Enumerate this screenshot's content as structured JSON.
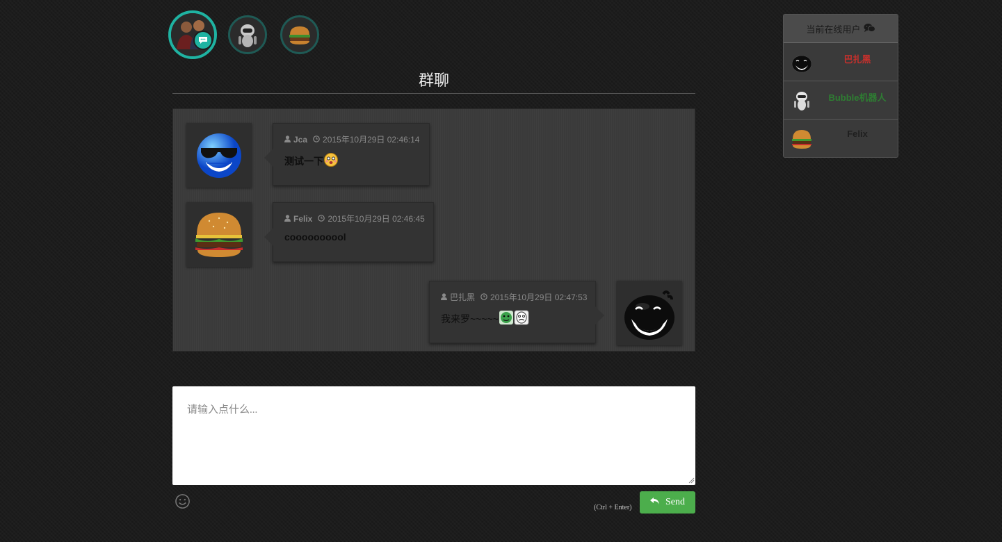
{
  "page_title": "群聊",
  "messages": [
    {
      "user": "Jca",
      "time": "2015年10月29日 02:46:14",
      "text": "测试一下",
      "avatar": "blue-sunglasses-smiley",
      "side": "left"
    },
    {
      "user": "Felix",
      "time": "2015年10月29日 02:46:45",
      "text": "coooooooool",
      "avatar": "hamburger",
      "side": "left"
    },
    {
      "user": "巴扎黑",
      "time": "2015年10月29日 02:47:53",
      "text": "我来罗~~~~~",
      "avatar": "black-laughing-blob",
      "side": "right"
    }
  ],
  "input": {
    "placeholder": "请输入点什么..."
  },
  "send": {
    "label": "Send",
    "shortcut": "(Ctrl + Enter)"
  },
  "online": {
    "title": "当前在线用户",
    "users": [
      {
        "name": "巴扎黑",
        "color": "#c9302c",
        "avatar": "black-blob"
      },
      {
        "name": "Bubble机器人",
        "color": "#2e7d32",
        "avatar": "robot"
      },
      {
        "name": "Felix",
        "color": "#1f1f1f",
        "avatar": "hamburger"
      }
    ]
  },
  "colors": {
    "accent_teal": "#1fb3a2",
    "send_green": "#4cae4c"
  }
}
